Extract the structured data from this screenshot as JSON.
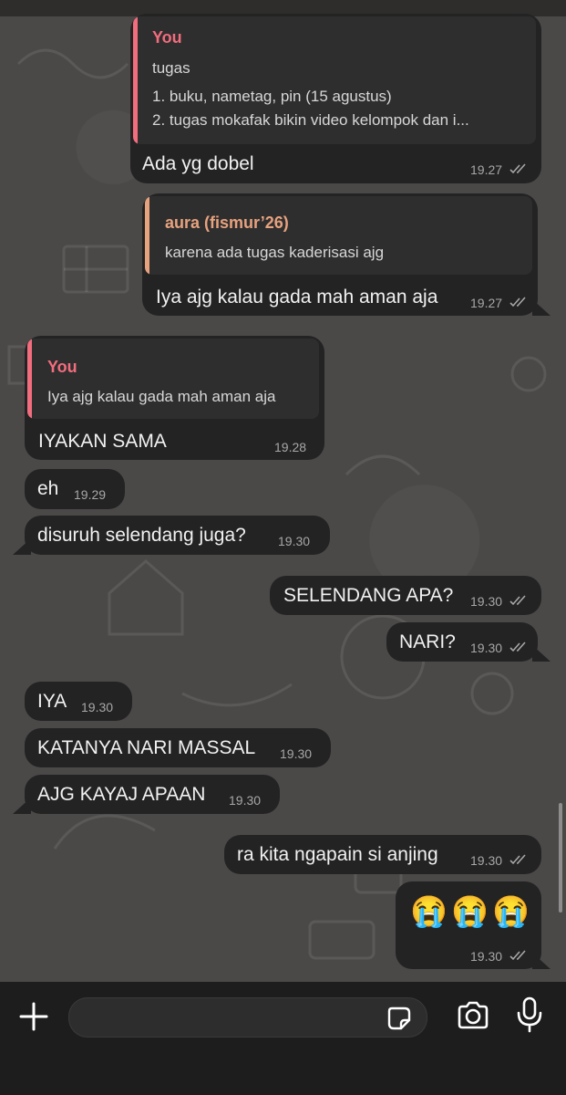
{
  "colors": {
    "you_author": "#f26d7d",
    "aura_author": "#e7a27e",
    "bubble": "#232324",
    "quote_bg": "#2e2e2f",
    "time": "#a7a7a7",
    "background": "#4b4948"
  },
  "messages": [
    {
      "direction": "out",
      "quote": {
        "author": "You",
        "lines": [
          "tugas",
          "1. buku, nametag, pin (15 agustus)",
          "2. tugas mokafak bikin video kelompok dan i..."
        ]
      },
      "text": "Ada yg dobel",
      "time": "19.27",
      "read_icon": "double-check-icon"
    },
    {
      "direction": "out",
      "quote": {
        "author": "aura (fismur’26)",
        "lines": [
          "karena ada tugas kaderisasi ajg"
        ]
      },
      "text": "Iya ajg kalau gada mah aman aja",
      "time": "19.27",
      "read_icon": "double-check-icon"
    },
    {
      "direction": "in",
      "quote": {
        "author": "You",
        "lines": [
          "Iya ajg kalau gada mah aman aja"
        ]
      },
      "text": "IYAKAN SAMA",
      "time": "19.28"
    },
    {
      "direction": "in",
      "text": "eh",
      "time": "19.29"
    },
    {
      "direction": "in",
      "text": "disuruh selendang juga?",
      "time": "19.30"
    },
    {
      "direction": "out",
      "text": "SELENDANG APA?",
      "time": "19.30",
      "read_icon": "double-check-icon"
    },
    {
      "direction": "out",
      "text": "NARI?",
      "time": "19.30",
      "read_icon": "double-check-icon"
    },
    {
      "direction": "in",
      "text": "IYA",
      "time": "19.30"
    },
    {
      "direction": "in",
      "text": "KATANYA NARI MASSAL",
      "time": "19.30"
    },
    {
      "direction": "in",
      "text": "AJG KAYAJ APAAN",
      "time": "19.30"
    },
    {
      "direction": "out",
      "text": "ra kita ngapain si anjing",
      "time": "19.30",
      "read_icon": "double-check-icon"
    },
    {
      "direction": "out",
      "text": "😭😭😭",
      "time": "19.30",
      "read_icon": "double-check-icon"
    }
  ],
  "input_bar": {
    "attach_icon": "plus-icon",
    "input_value": "",
    "sticker_icon": "sticker-icon",
    "camera_icon": "camera-icon",
    "mic_icon": "microphone-icon"
  }
}
